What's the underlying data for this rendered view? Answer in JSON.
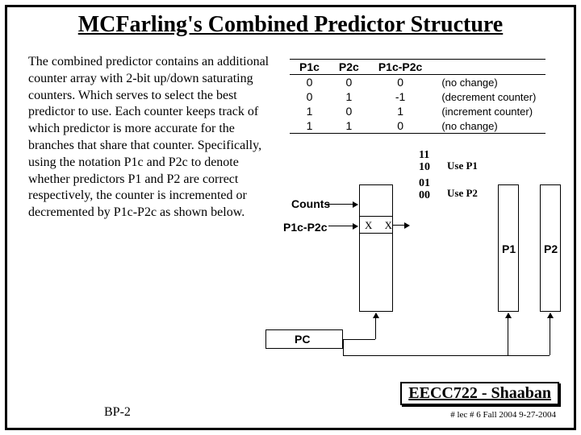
{
  "title": "MCFarling's Combined Predictor Structure",
  "body": "The combined predictor contains an additional counter array with 2-bit up/down saturating counters. Which serves to select the best predictor to use.\nEach counter keeps track of which predictor is more accurate for the branches that share that counter. Specifically, using the notation P1c and P2c to denote whether predictors P1 and P2 are correct respectively, the counter is incremented or decremented by P1c-P2c as shown below.",
  "table": {
    "headers": [
      "P1c",
      "P2c",
      "P1c-P2c",
      ""
    ],
    "rows": [
      [
        "0",
        "0",
        "0",
        "(no change)"
      ],
      [
        "0",
        "1",
        "-1",
        "(decrement counter)"
      ],
      [
        "1",
        "0",
        "1",
        "(increment counter)"
      ],
      [
        "1",
        "1",
        "0",
        "(no change)"
      ]
    ]
  },
  "labels": {
    "counts": "Counts",
    "p1cp2c": "P1c-P2c",
    "xx": "X X",
    "pc": "PC",
    "p1": "P1",
    "p2": "P2"
  },
  "state": {
    "s11": "11",
    "s10": "10",
    "s01": "01",
    "s00": "00",
    "useP1": "Use P1",
    "useP2": "Use P2"
  },
  "footer": {
    "course": "EECC722 - Shaaban",
    "lecture": "#  lec # 6   Fall 2004   9-27-2004",
    "slide": "BP-2"
  }
}
